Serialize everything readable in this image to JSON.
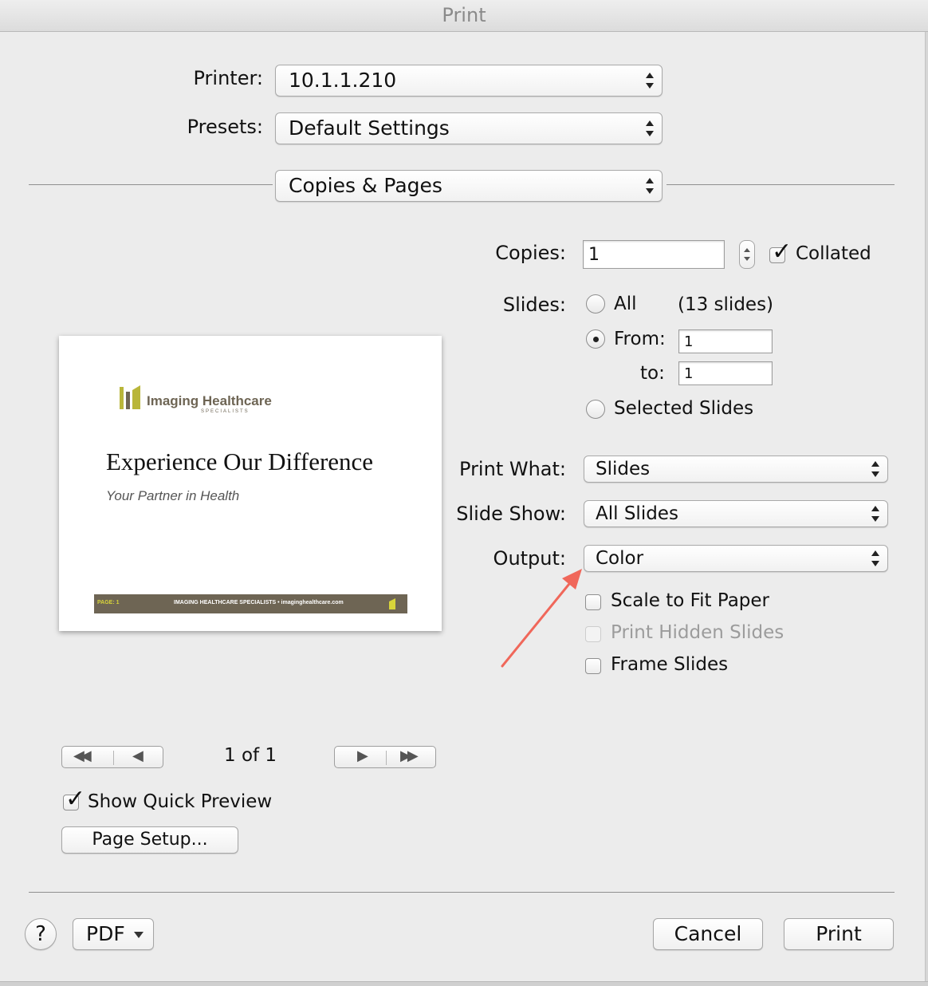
{
  "window": {
    "title": "Print"
  },
  "printer": {
    "label": "Printer:",
    "value": "10.1.1.210"
  },
  "presets": {
    "label": "Presets:",
    "value": "Default Settings"
  },
  "section": {
    "value": "Copies & Pages"
  },
  "copies": {
    "label": "Copies:",
    "value": "1",
    "collated_label": "Collated",
    "collated_checked": true
  },
  "slides": {
    "label": "Slides:",
    "all_label": "All",
    "count_text": "(13 slides)",
    "from_label": "From:",
    "from_value": "1",
    "to_label": "to:",
    "to_value": "1",
    "selected_label": "Selected Slides",
    "selected_option": "From"
  },
  "print_what": {
    "label": "Print What:",
    "value": "Slides"
  },
  "slide_show": {
    "label": "Slide Show:",
    "value": "All Slides"
  },
  "output": {
    "label": "Output:",
    "value": "Color"
  },
  "options": {
    "scale_label": "Scale to Fit Paper",
    "hidden_label": "Print Hidden Slides",
    "frame_label": "Frame Slides"
  },
  "preview": {
    "logo_text": "Imaging Healthcare",
    "logo_subtext": "SPECIALISTS",
    "title": "Experience Our Difference",
    "subtitle": "Your Partner in Health",
    "footer_page": "PAGE: 1",
    "footer_text": "IMAGING HEALTHCARE SPECIALISTS • imaginghealthcare.com"
  },
  "pager": {
    "text": "1 of 1"
  },
  "quick_preview": {
    "label": "Show Quick Preview",
    "checked": true
  },
  "page_setup": {
    "label": "Page Setup..."
  },
  "footer": {
    "help": "?",
    "pdf": "PDF",
    "cancel": "Cancel",
    "print": "Print"
  },
  "colors": {
    "accent_arrow": "#f0675a",
    "logo_green": "#b9b63a",
    "footer_bar": "#6e6554"
  }
}
